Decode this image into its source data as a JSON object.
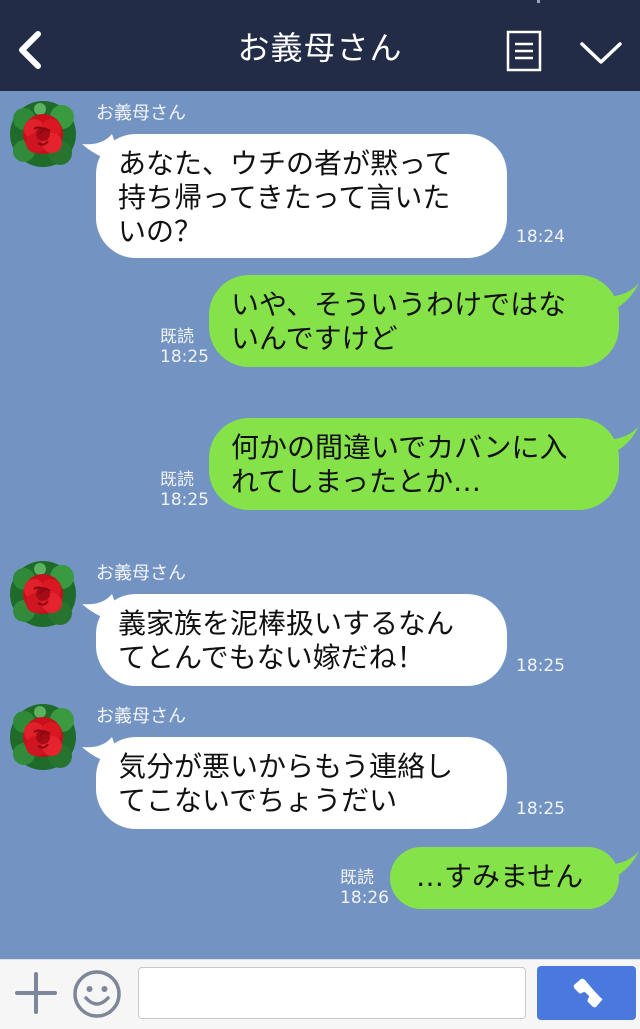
{
  "header": {
    "title": "お義母さん",
    "icons": {
      "back": "chevron-left-icon",
      "menu": "menu-list-icon",
      "collapse": "chevron-down-icon"
    }
  },
  "messages": [
    {
      "sender": "お義母さん",
      "direction": "incoming",
      "lines": [
        "あなた、ウチの者が黙って",
        "持ち帰ってきたって言いた",
        "いの？"
      ],
      "time": "18:24"
    },
    {
      "direction": "outgoing",
      "lines": [
        "いや、そういうわけではな",
        "いんですけど"
      ],
      "read": "既読",
      "time": "18:25"
    },
    {
      "direction": "outgoing",
      "lines": [
        "何かの間違いでカバンに入",
        "れてしまったとか…"
      ],
      "read": "既読",
      "time": "18:25"
    },
    {
      "sender": "お義母さん",
      "direction": "incoming",
      "lines": [
        "義家族を泥棒扱いするなん",
        "てとんでもない嫁だね！"
      ],
      "time": "18:25"
    },
    {
      "sender": "お義母さん",
      "direction": "incoming",
      "lines": [
        "気分が悪いからもう連絡し",
        "てこないでちょうだい"
      ],
      "time": "18:25"
    },
    {
      "direction": "outgoing",
      "lines": [
        "…すみません"
      ],
      "read": "既読",
      "time": "18:26"
    }
  ],
  "footer": {
    "input_value": "",
    "icons": {
      "plus": "plus-icon",
      "emoji": "smiley-icon",
      "call": "phone-icon"
    }
  },
  "colors": {
    "header_bg": "#232c47",
    "chat_bg": "#7393c2",
    "incoming_bubble": "#ffffff",
    "outgoing_bubble": "#85e249",
    "call_button": "#4a79dd"
  }
}
